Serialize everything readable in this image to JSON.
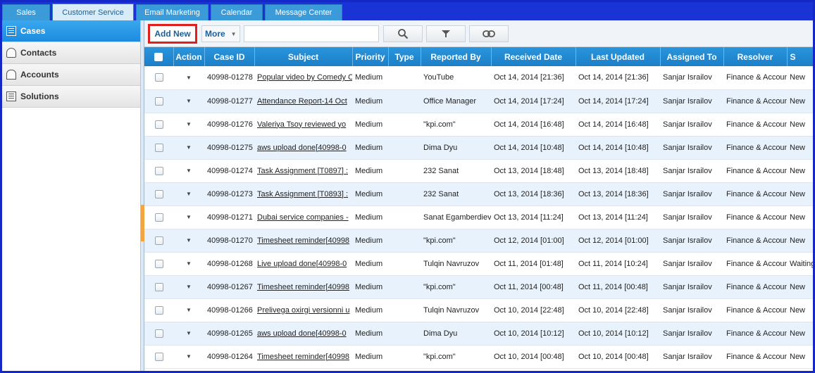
{
  "tabs": [
    {
      "label": "Sales",
      "active": false
    },
    {
      "label": "Customer Service",
      "active": true
    },
    {
      "label": "Email Marketing",
      "active": false
    },
    {
      "label": "Calendar",
      "active": false
    },
    {
      "label": "Message Center",
      "active": false
    }
  ],
  "sidebar": {
    "items": [
      {
        "label": "Cases",
        "icon": "cases-icon",
        "active": true
      },
      {
        "label": "Contacts",
        "icon": "contacts-icon",
        "active": false
      },
      {
        "label": "Accounts",
        "icon": "accounts-icon",
        "active": false
      },
      {
        "label": "Solutions",
        "icon": "solutions-icon",
        "active": false
      }
    ]
  },
  "toolbar": {
    "add_new_label": "Add New",
    "more_label": "More",
    "search_value": "",
    "search_icon": "search-icon",
    "filter_icon": "filter-icon",
    "link_icon": "link-icon"
  },
  "grid": {
    "columns": [
      "",
      "Action",
      "Case ID",
      "Subject",
      "Priority",
      "Type",
      "Reported By",
      "Received Date",
      "Last Updated",
      "Assigned To",
      "Resolver",
      "S"
    ],
    "rows": [
      {
        "case_id": "40998-01278",
        "subject": "Popular video by Comedy C",
        "priority": "Medium",
        "type": "",
        "reported_by": "YouTube",
        "received": "Oct 14, 2014 [21:36]",
        "updated": "Oct 14, 2014 [21:36]",
        "assigned": "Sanjar Israilov",
        "resolver": "Finance & Accoun",
        "status": "New"
      },
      {
        "case_id": "40998-01277",
        "subject": "Attendance Report-14 Oct",
        "priority": "Medium",
        "type": "",
        "reported_by": "Office Manager",
        "received": "Oct 14, 2014 [17:24]",
        "updated": "Oct 14, 2014 [17:24]",
        "assigned": "Sanjar Israilov",
        "resolver": "Finance & Accoun",
        "status": "New"
      },
      {
        "case_id": "40998-01276",
        "subject": "Valeriya Tsoy reviewed yo",
        "priority": "Medium",
        "type": "",
        "reported_by": "\"kpi.com\"",
        "received": "Oct 14, 2014 [16:48]",
        "updated": "Oct 14, 2014 [16:48]",
        "assigned": "Sanjar Israilov",
        "resolver": "Finance & Accoun",
        "status": "New"
      },
      {
        "case_id": "40998-01275",
        "subject": "aws upload done[40998-0",
        "priority": "Medium",
        "type": "",
        "reported_by": "Dima Dyu",
        "received": "Oct 14, 2014 [10:48]",
        "updated": "Oct 14, 2014 [10:48]",
        "assigned": "Sanjar Israilov",
        "resolver": "Finance & Accoun",
        "status": "New"
      },
      {
        "case_id": "40998-01274",
        "subject": "Task Assignment [T0897] :",
        "priority": "Medium",
        "type": "",
        "reported_by": "232 Sanat",
        "received": "Oct 13, 2014 [18:48]",
        "updated": "Oct 13, 2014 [18:48]",
        "assigned": "Sanjar Israilov",
        "resolver": "Finance & Accoun",
        "status": "New"
      },
      {
        "case_id": "40998-01273",
        "subject": "Task Assignment [T0893] :",
        "priority": "Medium",
        "type": "",
        "reported_by": "232 Sanat",
        "received": "Oct 13, 2014 [18:36]",
        "updated": "Oct 13, 2014 [18:36]",
        "assigned": "Sanjar Israilov",
        "resolver": "Finance & Accoun",
        "status": "New"
      },
      {
        "case_id": "40998-01271",
        "subject": "Dubai service companies -",
        "priority": "Medium",
        "type": "",
        "reported_by": "Sanat Egamberdiev",
        "received": "Oct 13, 2014 [11:24]",
        "updated": "Oct 13, 2014 [11:24]",
        "assigned": "Sanjar Israilov",
        "resolver": "Finance & Accoun",
        "status": "New"
      },
      {
        "case_id": "40998-01270",
        "subject": "Timesheet reminder[40998",
        "priority": "Medium",
        "type": "",
        "reported_by": "\"kpi.com\"",
        "received": "Oct 12, 2014 [01:00]",
        "updated": "Oct 12, 2014 [01:00]",
        "assigned": "Sanjar Israilov",
        "resolver": "Finance & Accoun",
        "status": "New"
      },
      {
        "case_id": "40998-01268",
        "subject": "Live upload done[40998-0",
        "priority": "Medium",
        "type": "",
        "reported_by": "Tulqin Navruzov",
        "received": "Oct 11, 2014 [01:48]",
        "updated": "Oct 11, 2014 [10:24]",
        "assigned": "Sanjar Israilov",
        "resolver": "Finance & Accoun",
        "status": "Waiting"
      },
      {
        "case_id": "40998-01267",
        "subject": "Timesheet reminder[40998",
        "priority": "Medium",
        "type": "",
        "reported_by": "\"kpi.com\"",
        "received": "Oct 11, 2014 [00:48]",
        "updated": "Oct 11, 2014 [00:48]",
        "assigned": "Sanjar Israilov",
        "resolver": "Finance & Accoun",
        "status": "New"
      },
      {
        "case_id": "40998-01266",
        "subject": "Prelivega oxirgi versionni u",
        "priority": "Medium",
        "type": "",
        "reported_by": "Tulqin Navruzov",
        "received": "Oct 10, 2014 [22:48]",
        "updated": "Oct 10, 2014 [22:48]",
        "assigned": "Sanjar Israilov",
        "resolver": "Finance & Accoun",
        "status": "New"
      },
      {
        "case_id": "40998-01265",
        "subject": "aws upload done[40998-0",
        "priority": "Medium",
        "type": "",
        "reported_by": "Dima Dyu",
        "received": "Oct 10, 2014 [10:12]",
        "updated": "Oct 10, 2014 [10:12]",
        "assigned": "Sanjar Israilov",
        "resolver": "Finance & Accoun",
        "status": "New"
      },
      {
        "case_id": "40998-01264",
        "subject": "Timesheet reminder[40998",
        "priority": "Medium",
        "type": "",
        "reported_by": "\"kpi.com\"",
        "received": "Oct 10, 2014 [00:48]",
        "updated": "Oct 10, 2014 [00:48]",
        "assigned": "Sanjar Israilov",
        "resolver": "Finance & Accoun",
        "status": "New"
      }
    ]
  },
  "colors": {
    "frame": "#1a33d6",
    "tab": "#3b9bd9",
    "header": "#1b7fc8",
    "alt_row": "#e8f2fc",
    "highlight": "#e0201c"
  }
}
